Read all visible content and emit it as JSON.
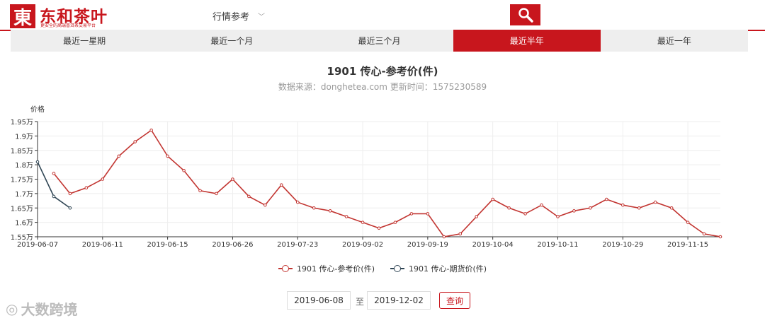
{
  "header": {
    "logo_char": "東",
    "logo_title": "东和茶叶",
    "logo_subtitle": "更安全的高端普洱茶交易平台",
    "search_select": "行情参考",
    "search_placeholder": ""
  },
  "tabs": [
    {
      "label": "最近一星期",
      "active": false
    },
    {
      "label": "最近一个月",
      "active": false
    },
    {
      "label": "最近三个月",
      "active": false
    },
    {
      "label": "最近半年",
      "active": true
    },
    {
      "label": "最近一年",
      "active": false
    }
  ],
  "chart_title": "1901 传心-参考价(件)",
  "chart_subtitle": "数据来源：donghetea.com 更新时间：1575230589",
  "chart_data": {
    "type": "line",
    "ylabel": "价格",
    "ylim": [
      15500,
      19500
    ],
    "yticks": [
      "1.55万",
      "1.6万",
      "1.65万",
      "1.7万",
      "1.75万",
      "1.8万",
      "1.85万",
      "1.9万",
      "1.95万"
    ],
    "xticks": [
      "2019-06-07",
      "2019-06-11",
      "2019-06-15",
      "2019-06-26",
      "2019-07-23",
      "2019-09-02",
      "2019-09-19",
      "2019-10-04",
      "2019-10-11",
      "2019-10-29",
      "2019-11-15"
    ],
    "grid": true,
    "legend_position": "bottom",
    "series": [
      {
        "name": "1901 传心-参考价(件)",
        "color": "#c23531",
        "values": [
          null,
          17700,
          17000,
          17200,
          17500,
          18300,
          18800,
          19200,
          18300,
          17800,
          17100,
          17000,
          17500,
          16900,
          16600,
          17300,
          16700,
          16500,
          16400,
          16200,
          16000,
          15800,
          16000,
          16300,
          16300,
          15500,
          15600,
          16200,
          16800,
          16500,
          16300,
          16600,
          16200,
          16400,
          16500,
          16800,
          16600,
          16500,
          16700,
          16500,
          16000,
          15600,
          15500
        ]
      },
      {
        "name": "1901 传心-期货价(件)",
        "color": "#2f4554",
        "values": [
          18100,
          16900,
          16500
        ]
      }
    ]
  },
  "date_range": {
    "start": "2019-06-08",
    "separator": "至",
    "end": "2019-12-02",
    "query_label": "查询"
  },
  "watermark": "大数跨境"
}
